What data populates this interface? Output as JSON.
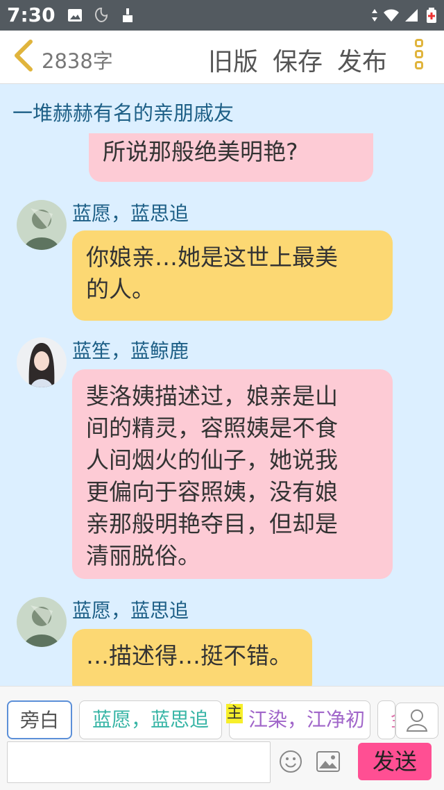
{
  "status_bar": {
    "time": "7:30"
  },
  "app_bar": {
    "word_count": "2838字",
    "buttons": [
      "旧版",
      "保存",
      "发布"
    ]
  },
  "chat": {
    "title": "一堆赫赫有名的亲朋戚友",
    "messages": [
      {
        "speaker": "",
        "text": "所说那般绝美明艳?"
      },
      {
        "speaker": "蓝愿，蓝思追",
        "text_lines": [
          "你娘亲…她是这世上最美",
          "的人。"
        ]
      },
      {
        "speaker": "蓝笙，蓝鲸鹿",
        "text_lines": [
          "斐洛姨描述过，娘亲是山",
          "间的精灵，容照姨是不食",
          "人间烟火的仙子，她说我",
          "更偏向于容照姨，没有娘",
          "亲那般明艳夺目，但却是",
          "清丽脱俗。"
        ]
      },
      {
        "speaker": "蓝愿，蓝思追",
        "text": "…描述得…挺不错。"
      }
    ]
  },
  "role_chips": [
    {
      "label": "旁白"
    },
    {
      "label": "蓝愿，蓝思追"
    },
    {
      "label": "江染，江净初",
      "badge": "主"
    },
    {
      "label": "金"
    }
  ],
  "composer": {
    "input_value": "",
    "input_placeholder": "",
    "send_label": "发送"
  },
  "colors": {
    "status_bar": "#535a60",
    "chat_bg": "#dcefff",
    "bubble_pink": "#fdcbd5",
    "bubble_yellow": "#fcd873",
    "accent_send": "#ff4f93",
    "speaker_text": "#1d5f86"
  },
  "icons": [
    "image-icon",
    "app-icon",
    "cleaning-icon",
    "data-arrows-icon",
    "wifi-icon",
    "signal-icon",
    "battery-icon",
    "back-chevron-icon",
    "more-menu-icon",
    "user-icon",
    "emoji-icon",
    "picture-icon"
  ]
}
